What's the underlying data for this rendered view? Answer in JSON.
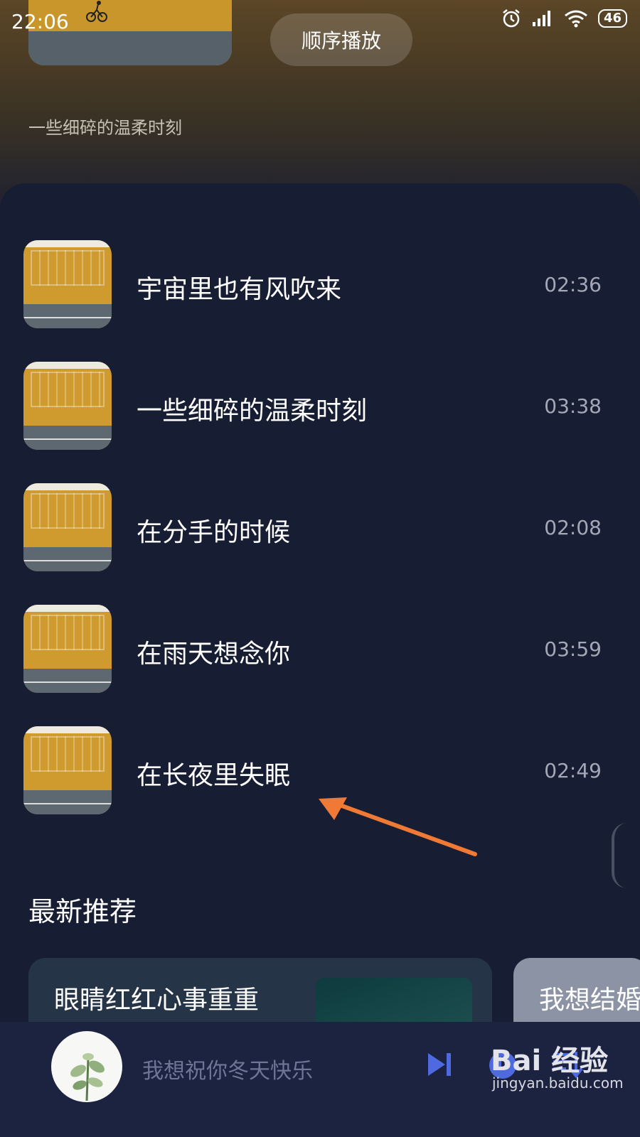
{
  "status_bar": {
    "time": "22:06",
    "battery": "46"
  },
  "header": {
    "order_mode_label": "顺序播放",
    "description": "一些细碎的温柔时刻"
  },
  "songs": [
    {
      "title": "宇宙里也有风吹来",
      "duration": "02:36"
    },
    {
      "title": "一些细碎的温柔时刻",
      "duration": "03:38"
    },
    {
      "title": "在分手的时候",
      "duration": "02:08"
    },
    {
      "title": "在雨天想念你",
      "duration": "03:59"
    },
    {
      "title": "在长夜里失眠",
      "duration": "02:49"
    }
  ],
  "recommend": {
    "title": "最新推荐",
    "cards": [
      {
        "name": "眼睛红红心事重重"
      },
      {
        "name": "我想结婚"
      }
    ]
  },
  "player": {
    "now_playing": "我想祝你冬天快乐"
  },
  "watermark": {
    "logo": "Bai 经验",
    "url": "jingyan.baidu.com"
  },
  "colors": {
    "panel": "#171d32",
    "player_bar": "#1b2341",
    "accent_arrow": "#f07a35",
    "icon_blue": "#4f6ae0"
  }
}
